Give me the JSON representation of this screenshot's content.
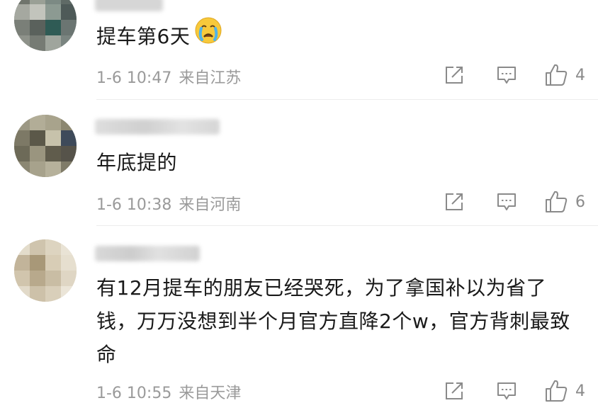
{
  "comments": [
    {
      "text": "提车第6天",
      "emoji": "crying-face",
      "time": "1-6 10:47",
      "location": "来自江苏",
      "likes": "4"
    },
    {
      "text": "年底提的",
      "time": "1-6 10:38",
      "location": "来自河南",
      "likes": "6"
    },
    {
      "text": "有12月提车的朋友已经哭死，为了拿国补以为省了钱，万万没想到半个月官方直降2个w，官方背刺最致命",
      "time": "1-6 10:55",
      "location": "来自天津",
      "likes": "4"
    }
  ],
  "colors": {
    "text": "#1a1a1a",
    "meta": "#9a9a9a",
    "icon": "#8a8a8a",
    "divider": "#ececec"
  },
  "icons": {
    "share": "share-icon",
    "reply": "reply-icon",
    "like": "thumbs-up-icon"
  }
}
